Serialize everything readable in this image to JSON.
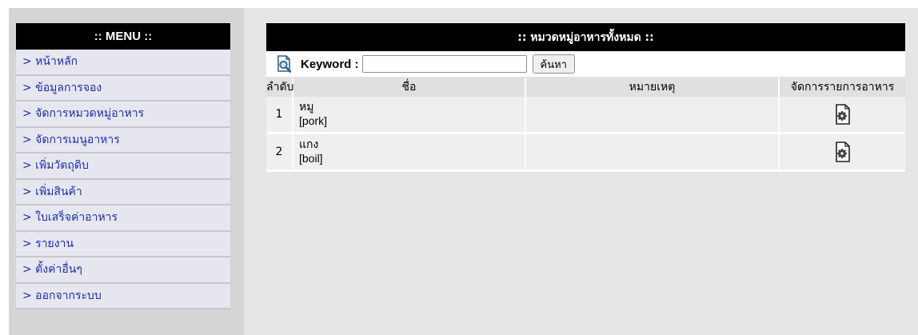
{
  "menu": {
    "title": ":: MENU ::",
    "items": [
      {
        "label": "> หน้าหลัก"
      },
      {
        "label": "> ข้อมูลการจอง"
      },
      {
        "label": "> จัดการหมวดหมู่อาหาร"
      },
      {
        "label": "> จัดการเมนูอาหาร"
      },
      {
        "label": "> เพิ่มวัตถุดิบ"
      },
      {
        "label": "> เพิ่มสินค้า"
      },
      {
        "label": "> ใบเสร็จค่าอาหาร"
      },
      {
        "label": "> รายงาน"
      },
      {
        "label": "> ตั้งค่าอื่นๆ"
      },
      {
        "label": "> ออกจากระบบ"
      }
    ]
  },
  "content": {
    "title": ":: หมวดหมู่อาหารทั้งหมด ::",
    "search": {
      "label": "Keyword :",
      "value": "",
      "placeholder": "",
      "button_label": "ค้นหา",
      "icon": "search-document-icon"
    },
    "table": {
      "columns": [
        "ลำดับ",
        "ชื่อ",
        "หมายเหตุ",
        "จัดการรายการอาหาร"
      ],
      "rows": [
        {
          "no": "1",
          "name": "หมู",
          "name_en": "[pork]",
          "note": "",
          "action_icon": "gear-document-icon"
        },
        {
          "no": "2",
          "name": "แกง",
          "name_en": "[boil]",
          "note": "",
          "action_icon": "gear-document-icon"
        }
      ]
    }
  },
  "colors": {
    "header_bg": "#000000",
    "menu_item_bg": "#e6e6ef",
    "menu_link": "#1d2fa8",
    "page_bg": "#e5e5e5",
    "row_bg": "#efefef"
  }
}
